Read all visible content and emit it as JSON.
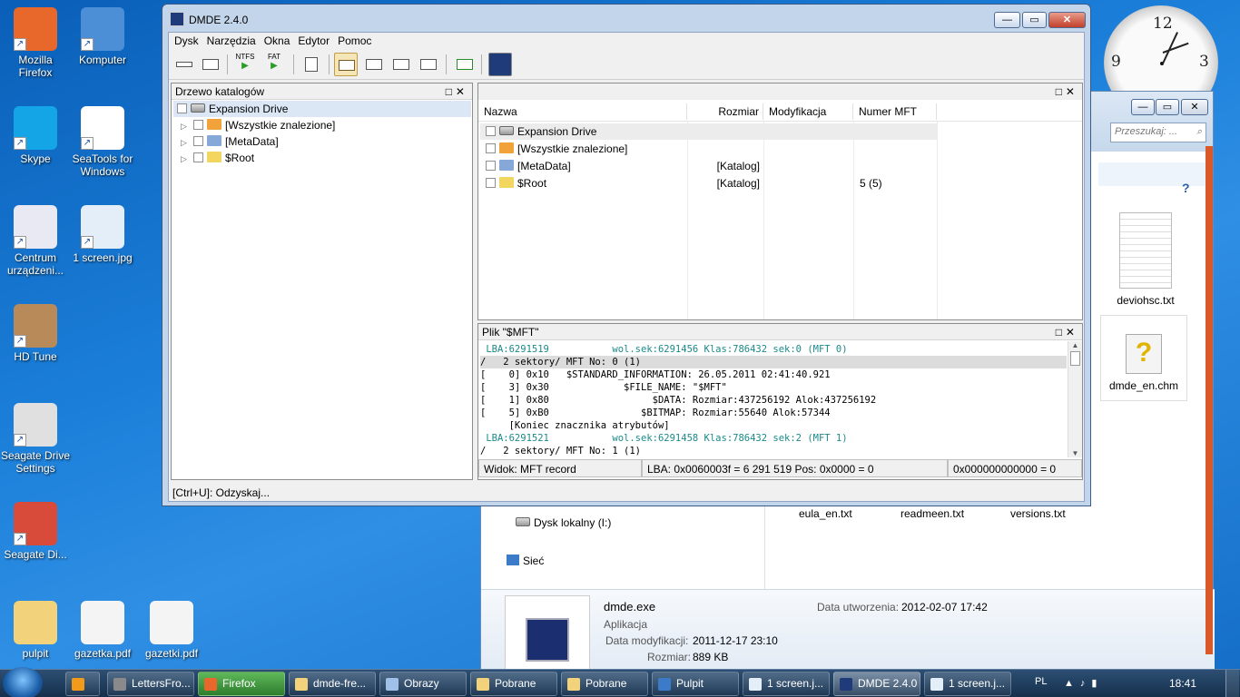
{
  "desktop": {
    "icons": [
      {
        "label": "Mozilla\nFirefox",
        "icon": "firefox-icon",
        "color": "#e8672a"
      },
      {
        "label": "Komputer",
        "icon": "computer-icon",
        "color": "#4d8fd6"
      },
      {
        "label": "Skype",
        "icon": "skype-icon",
        "color": "#14a5e6"
      },
      {
        "label": "SeaTools for\nWindows",
        "icon": "seatools-icon",
        "color": "#ffffff"
      },
      {
        "label": "Centrum\nurządzeni...",
        "icon": "device-center-icon",
        "color": "#e9e9f3"
      },
      {
        "label": "1 screen.jpg",
        "icon": "image-file-icon",
        "color": "#e4eef8"
      },
      {
        "label": "HD Tune",
        "icon": "hdtune-icon",
        "color": "#b88a5a"
      },
      {
        "label": "Seagate Drive\nSettings",
        "icon": "seagate-icon",
        "color": "#e0e0e0"
      },
      {
        "label": "Seagate Di...",
        "icon": "seagate-installer-icon",
        "color": "#d84b3a"
      },
      {
        "label": "pulpit",
        "icon": "folder-icon",
        "color": "#f2d27a"
      },
      {
        "label": "gazetka.pdf",
        "icon": "pdf-icon",
        "color": "#f4f4f4"
      },
      {
        "label": "gazetki.pdf",
        "icon": "pdf-icon",
        "color": "#f4f4f4"
      }
    ]
  },
  "clock": {
    "n12": "12",
    "n3": "3",
    "n9": "9"
  },
  "dmde": {
    "title": "DMDE 2.4.0",
    "menu": [
      "Dysk",
      "Narzędzia",
      "Okna",
      "Edytor",
      "Pomoc"
    ],
    "toolbar": {
      "ntfs": "NTFS",
      "fat": "FAT"
    },
    "tree": {
      "title": "Drzewo katalogów",
      "items": [
        "Expansion Drive",
        "[Wszystkie znalezione]",
        "[MetaData]",
        "$Root"
      ]
    },
    "list": {
      "columns": [
        "Nazwa",
        "Rozmiar",
        "Modyfikacja",
        "Numer MFT"
      ],
      "rows": [
        {
          "name": "Expansion Drive",
          "size": "",
          "mod": "",
          "mft": ""
        },
        {
          "name": "[Wszystkie znalezione]",
          "size": "",
          "mod": "",
          "mft": ""
        },
        {
          "name": "[MetaData]",
          "size": "[Katalog]",
          "mod": "",
          "mft": ""
        },
        {
          "name": "$Root",
          "size": "[Katalog]",
          "mod": "",
          "mft": "5 (5)"
        }
      ]
    },
    "hex": {
      "title": "Plik \"$MFT\"",
      "lines": [
        " LBA:6291519           wol.sek:6291456 Klas:786432 sek:0 (MFT 0)",
        "/   2 sektory/ MFT No: 0 (1)",
        "[    0] 0x10   $STANDARD_INFORMATION: 26.05.2011 02:41:40.921",
        "[    3] 0x30             $FILE_NAME: \"$MFT\"",
        "[    1] 0x80                  $DATA: Rozmiar:437256192 Alok:437256192",
        "[    5] 0xB0                $BITMAP: Rozmiar:55640 Alok:57344",
        "     [Koniec znacznika atrybutów]",
        " LBA:6291521           wol.sek:6291458 Klas:786432 sek:2 (MFT 1)",
        "/   2 sektory/ MFT No: 1 (1)"
      ],
      "status": [
        "Widok: MFT record",
        "LBA: 0x0060003f = 6 291 519  Pos: 0x0000 = 0",
        "0x000000000000 = 0"
      ]
    },
    "statusbar": "[Ctrl+U]: Odzyskaj..."
  },
  "explorer": {
    "search_placeholder": "Przeszukaj: ...",
    "files": [
      "deviohsc.txt",
      "dmde_en.chm",
      "eula_en.txt",
      "readmeen.txt",
      "versions.txt"
    ],
    "nav": [
      "Dysk lokalny (I:)",
      "Sieć"
    ],
    "details": {
      "name": "dmde.exe",
      "type": "Aplikacja",
      "created_label": "Data utworzenia:",
      "created": "2012-02-07 17:42",
      "modified_label": "Data modyfikacji:",
      "modified": "2011-12-17 23:10",
      "size_label": "Rozmiar:",
      "size": "889 KB"
    }
  },
  "taskbar": {
    "items": [
      "LettersFro...",
      "Firefox",
      "dmde-fre...",
      "Obrazy",
      "Pobrane",
      "Pobrane",
      "Pulpit",
      "1 screen.j...",
      "DMDE 2.4.0",
      "1 screen.j..."
    ],
    "lang": "PL",
    "time": "18:41"
  }
}
